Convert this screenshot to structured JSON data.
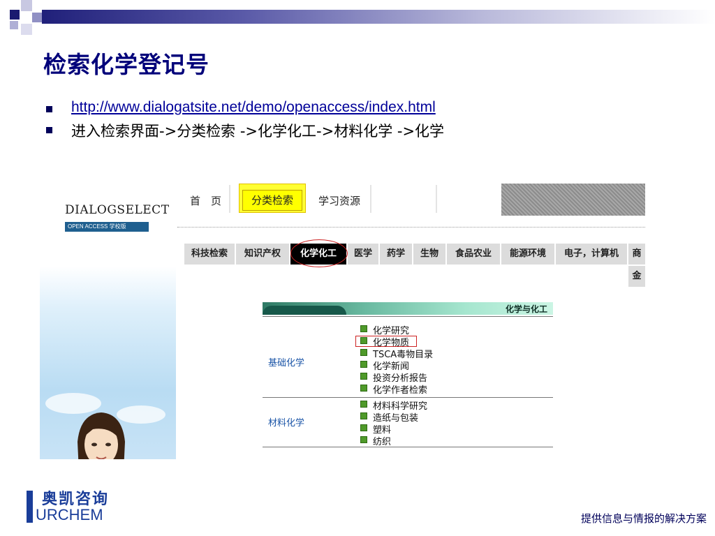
{
  "slide": {
    "title": "检索化学登记号",
    "bullets": [
      "http://www.dialogatsite.net/demo/openaccess/index.html",
      "进入检索界面->分类检索 ->化学化工->材料化学 ->化学"
    ]
  },
  "screenshot": {
    "logo": "DIALOGSELECT",
    "logo_sub": "OPEN ACCESS 学校版",
    "nav": [
      "首　页",
      "分类检索",
      "学习资源"
    ],
    "categories": [
      "科技检索",
      "知识产权",
      "化学化工",
      "医学",
      "药学",
      "生物",
      "食品农业",
      "能源环境",
      "电子，计算机",
      "商"
    ],
    "category_overflow": "金",
    "active_category": "化学化工",
    "panel": {
      "title": "化学与化工",
      "sections": [
        {
          "label": "基础化学",
          "items": [
            "化学研究",
            "化学物质",
            "TSCA毒物目录",
            "化学新闻",
            "投资分析报告",
            "化学作者检索"
          ]
        },
        {
          "label": "材料化学",
          "items": [
            "材料科学研究",
            "造纸与包装",
            "塑料",
            "纺织"
          ]
        }
      ],
      "highlighted_item": "化学物质"
    }
  },
  "footer": {
    "logo_cn": "奥凯咨询",
    "logo_en": "URCHEM",
    "slogan": "提供信息与情报的解决方案"
  },
  "colors": {
    "title": "#00007a",
    "link": "#000099",
    "active_tab": "#000000",
    "highlight": "#ffff00",
    "circle": "#cc2222",
    "footer": "#1a3d99"
  }
}
